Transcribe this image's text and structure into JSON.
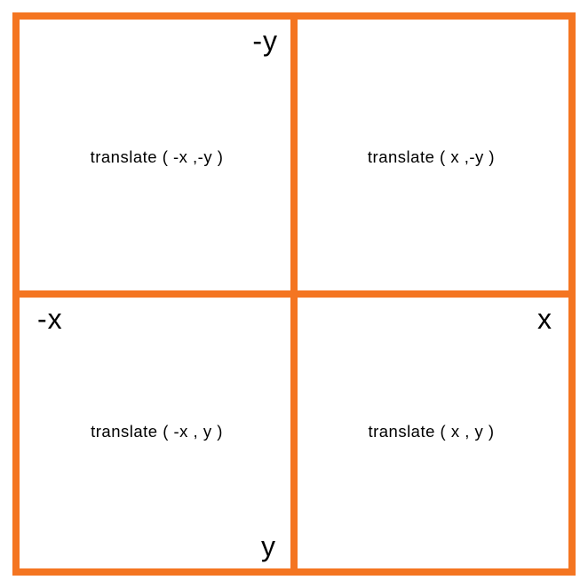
{
  "axes": {
    "neg_y": "-y",
    "neg_x": "-x",
    "pos_x": "x",
    "pos_y": "y"
  },
  "quadrants": {
    "top_left": "translate ( -x ,-y )",
    "top_right": "translate ( x ,-y )",
    "bottom_left": "translate ( -x , y )",
    "bottom_right": "translate ( x , y )"
  },
  "colors": {
    "accent": "#f47521"
  }
}
